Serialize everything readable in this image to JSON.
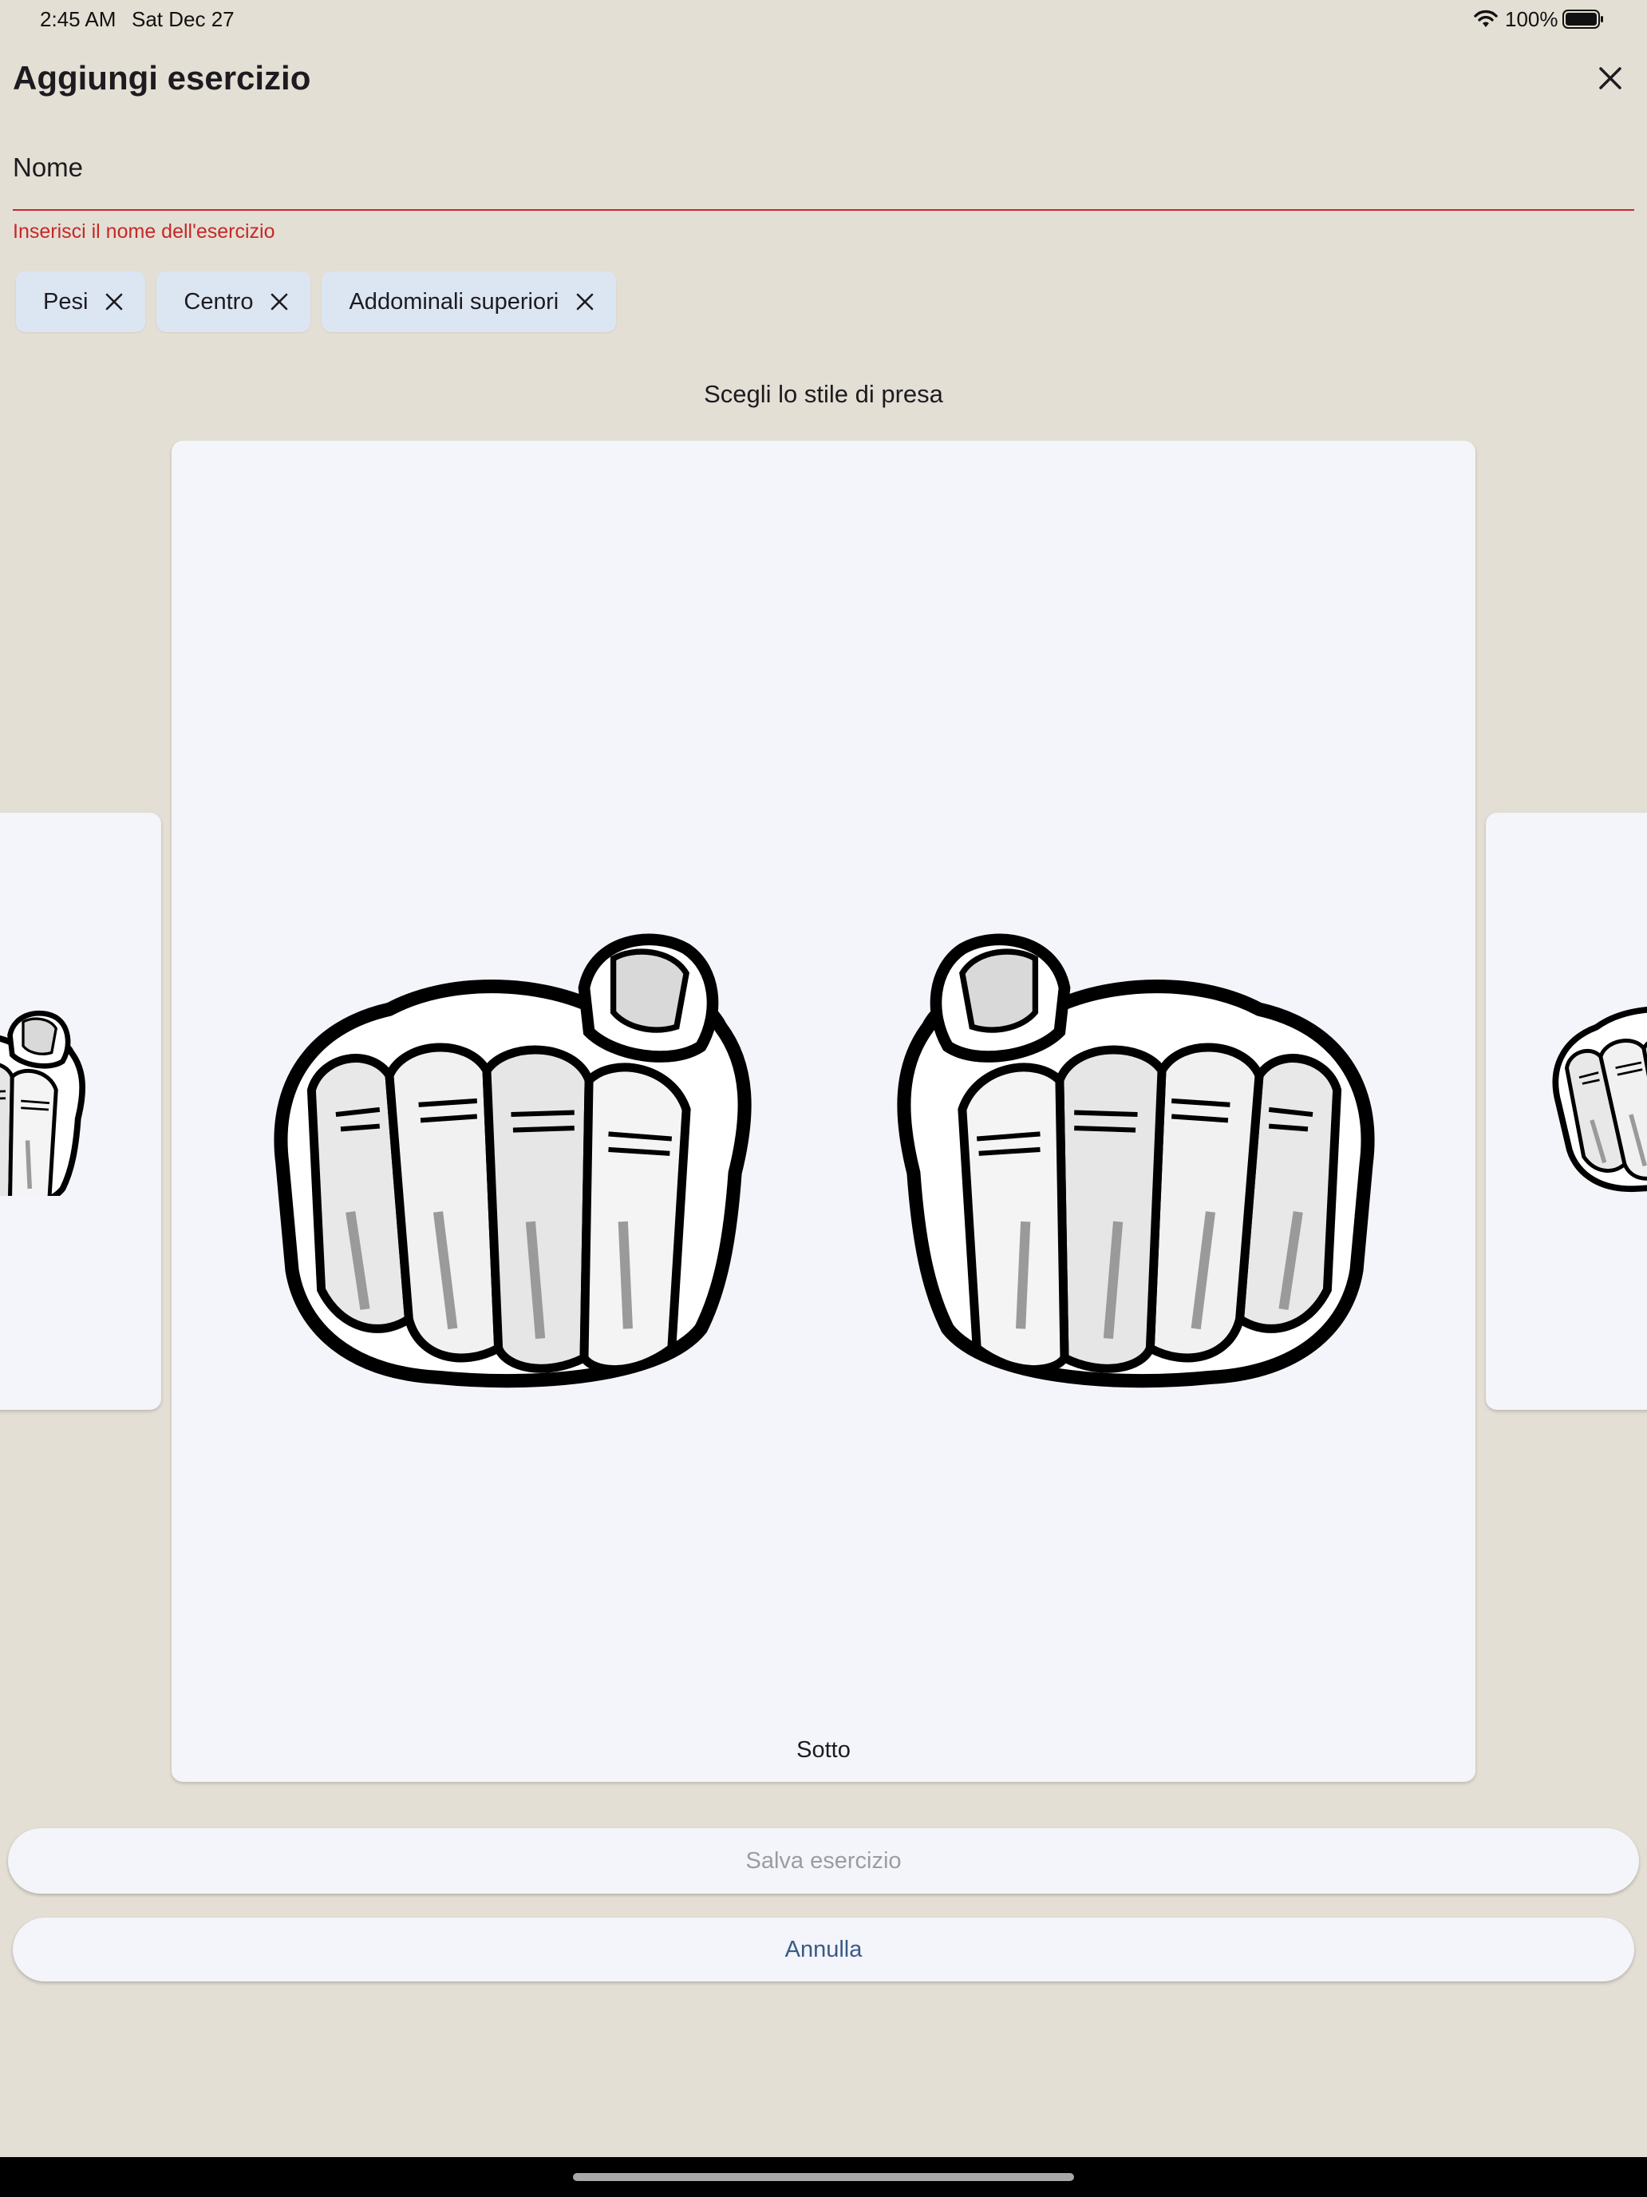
{
  "status_bar": {
    "time": "2:45 AM",
    "date": "Sat Dec 27",
    "battery": "100%"
  },
  "dialog": {
    "title": "Aggiungi esercizio"
  },
  "name_field": {
    "label": "Nome",
    "value": "",
    "error": "Inserisci il nome dell'esercizio"
  },
  "chips": [
    {
      "label": "Pesi"
    },
    {
      "label": "Centro"
    },
    {
      "label": "Addominali superiori"
    }
  ],
  "grip": {
    "prompt": "Scegli lo stile di presa",
    "selected_caption": "Sotto"
  },
  "actions": {
    "save_label": "Salva esercizio",
    "cancel_label": "Annulla"
  },
  "colors": {
    "background": "#e4dfd4",
    "error": "#c62828",
    "chip": "#dce6f3",
    "card": "#f3f5fa",
    "cancel_text": "#3a5a86",
    "disabled_text": "#9c9ca0"
  }
}
